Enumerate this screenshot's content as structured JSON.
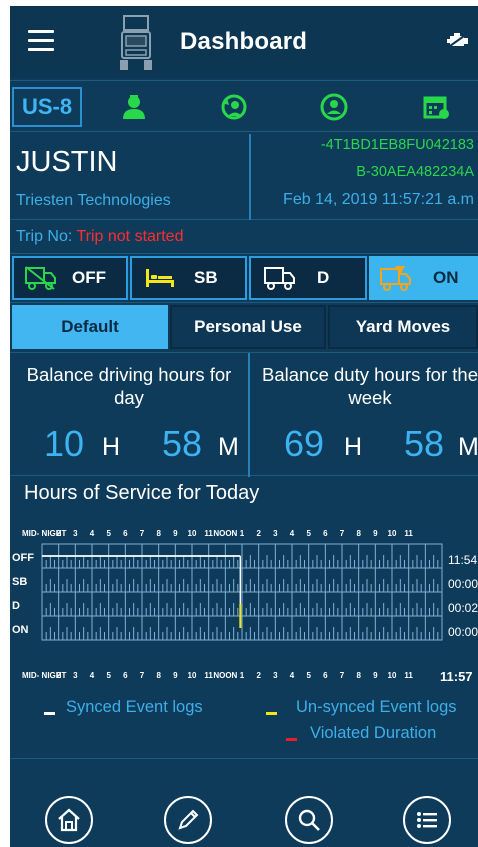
{
  "app": {
    "title": "Dashboard"
  },
  "vehicle": {
    "unit": "US-8"
  },
  "driver": {
    "name": "JUSTIN",
    "company": "Triesten Technologies",
    "vin_line1": "-4T1BD1EB8FU042183",
    "vin_line2": "B-30AEA482234A",
    "datetime": "Feb 14, 2019 11:57:21 a.m"
  },
  "trip": {
    "label": "Trip No: ",
    "value": "Trip not started"
  },
  "statuses": [
    {
      "label": "OFF",
      "icon": "off-duty-truck-icon",
      "active": false
    },
    {
      "label": "SB",
      "icon": "sleeper-bed-icon",
      "active": false
    },
    {
      "label": "D",
      "icon": "driving-truck-icon",
      "active": false
    },
    {
      "label": "ON",
      "icon": "on-duty-truck-icon",
      "active": true
    }
  ],
  "modes": [
    {
      "label": "Default",
      "active": true
    },
    {
      "label": "Personal Use",
      "active": false
    },
    {
      "label": "Yard Moves",
      "active": false
    }
  ],
  "balance": {
    "day": {
      "title_line1": "Balance driving hours for",
      "title_line2": "day",
      "hours": "10",
      "h_unit": "H",
      "minutes": "58",
      "m_unit": "M"
    },
    "week": {
      "title_line1": "Balance duty hours for the",
      "title_line2": "week",
      "hours": "69",
      "h_unit": "H",
      "minutes": "58",
      "m_unit": "M"
    }
  },
  "hos": {
    "title": "Hours of Service for Today",
    "top_hours": [
      "MID- NIGHT",
      "2",
      "3",
      "4",
      "5",
      "6",
      "7",
      "8",
      "9",
      "10",
      "11",
      "NOON",
      "1",
      "2",
      "3",
      "4",
      "5",
      "6",
      "7",
      "8",
      "9",
      "10",
      "11"
    ],
    "bottom_hours": [
      "MID- NIGHT",
      "2",
      "3",
      "4",
      "5",
      "6",
      "7",
      "8",
      "9",
      "10",
      "11",
      "NOON",
      "1",
      "2",
      "3",
      "4",
      "5",
      "6",
      "7",
      "8",
      "9",
      "10",
      "11"
    ],
    "rows": [
      "OFF",
      "SB",
      "D",
      "ON"
    ],
    "totals": [
      "11:54",
      "00:00",
      "00:02",
      "00:00"
    ],
    "grand_total": "11:57"
  },
  "legend": {
    "synced": "Synced Event logs",
    "unsynced": "Un-synced Event logs",
    "violated": "Violated Duration",
    "colors": {
      "synced": "#ffffff",
      "unsynced": "#f5e61c",
      "violated": "#e81e2b"
    }
  },
  "bottom_nav": [
    {
      "name": "home-icon"
    },
    {
      "name": "edit-pencil-icon"
    },
    {
      "name": "search-icon"
    },
    {
      "name": "list-menu-icon"
    }
  ],
  "colors": {
    "accent": "#3cb5ef",
    "background": "#0e3b5a",
    "green": "#29d74a",
    "red": "#ff2d2d"
  }
}
